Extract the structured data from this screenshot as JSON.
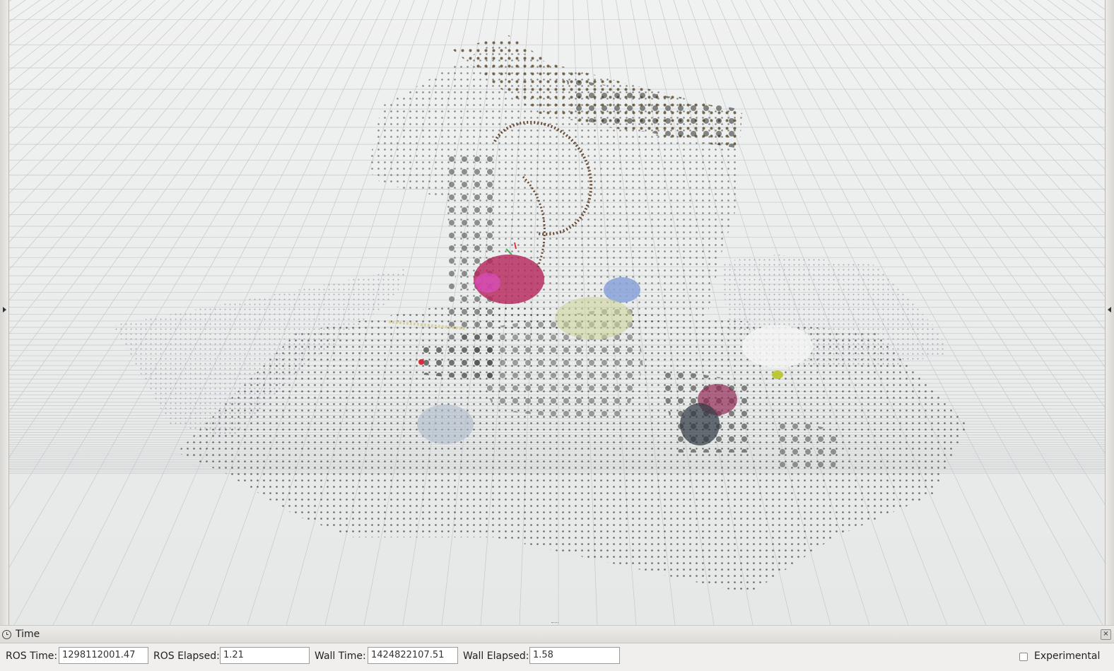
{
  "viewport": {
    "background_color": "#e9ebeb",
    "grid_color": "#c4c8ca"
  },
  "time_panel": {
    "icon": "clock-icon",
    "title": "Time",
    "close_icon": "close-icon",
    "ros_time_label": "ROS Time:",
    "ros_time_value": "1298112001.47",
    "ros_elapsed_label": "ROS Elapsed:",
    "ros_elapsed_value": "1.21",
    "wall_time_label": "Wall Time:",
    "wall_time_value": "1424822107.51",
    "wall_elapsed_label": "Wall Elapsed:",
    "wall_elapsed_value": "1.58",
    "experimental_label": "Experimental",
    "experimental_checked": false
  }
}
